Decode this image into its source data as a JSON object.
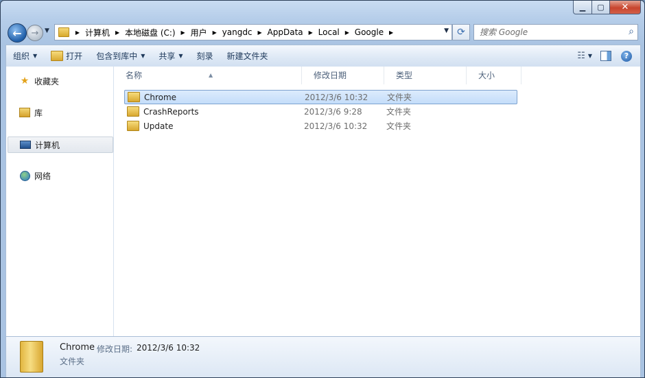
{
  "window": {
    "minimize": "▁",
    "maximize": "▢",
    "close": "✕"
  },
  "address": {
    "crumbs": [
      "计算机",
      "本地磁盘 (C:)",
      "用户",
      "yangdc",
      "AppData",
      "Local",
      "Google"
    ]
  },
  "search": {
    "placeholder": "搜索 Google"
  },
  "toolbar": {
    "organize": "组织",
    "open": "打开",
    "include_in_library": "包含到库中",
    "share": "共享",
    "burn": "刻录",
    "new_folder": "新建文件夹"
  },
  "nav": {
    "favorites": "收藏夹",
    "libraries": "库",
    "computer": "计算机",
    "network": "网络"
  },
  "columns": {
    "name": "名称",
    "date_modified": "修改日期",
    "type": "类型",
    "size": "大小"
  },
  "files": [
    {
      "name": "Chrome",
      "date": "2012/3/6 10:32",
      "type": "文件夹",
      "selected": true
    },
    {
      "name": "CrashReports",
      "date": "2012/3/6 9:28",
      "type": "文件夹",
      "selected": false
    },
    {
      "name": "Update",
      "date": "2012/3/6 10:32",
      "type": "文件夹",
      "selected": false
    }
  ],
  "details": {
    "name": "Chrome",
    "date_label": "修改日期:",
    "date_value": "2012/3/6 10:32",
    "type": "文件夹"
  }
}
